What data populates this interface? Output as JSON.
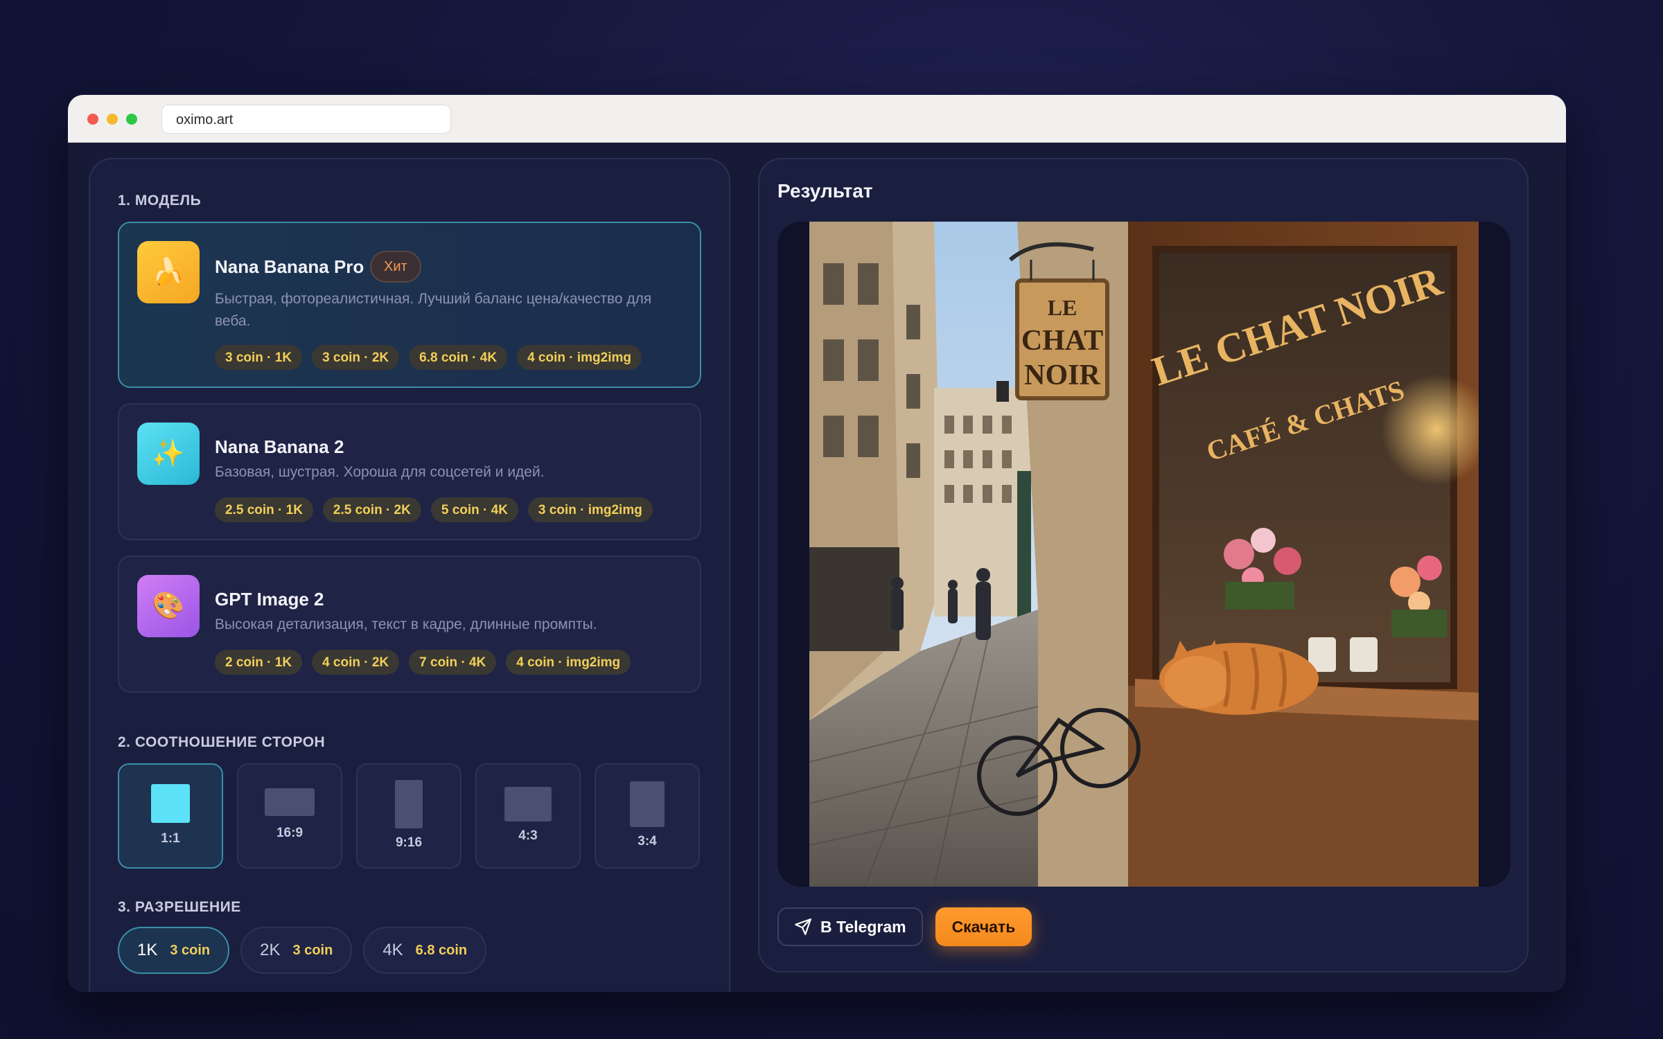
{
  "browser": {
    "url": "oximo.art"
  },
  "left": {
    "model_section_title": "1. МОДЕЛЬ",
    "models": [
      {
        "name": "Nana Banana Pro",
        "badge": "Хит",
        "icon": "banana-icon",
        "description": "Быстрая, фотореалистичная. Лучший баланс цена/качество для веба.",
        "prices": [
          "3 coin · 1K",
          "3 coin · 2K",
          "6.8 coin · 4K",
          "4 coin · img2img"
        ],
        "selected": true
      },
      {
        "name": "Nana Banana 2",
        "icon": "sparkles-icon",
        "description": "Базовая, шустрая. Хороша для соцсетей и идей.",
        "prices": [
          "2.5 coin · 1K",
          "2.5 coin · 2K",
          "5 coin · 4K",
          "3 coin · img2img"
        ],
        "selected": false
      },
      {
        "name": "GPT Image 2",
        "icon": "palette-icon",
        "description": "Высокая детализация, текст в кадре, длинные промпты.",
        "prices": [
          "2 coin · 1K",
          "4 coin · 2K",
          "7 coin · 4K",
          "4 coin · img2img"
        ],
        "selected": false
      }
    ],
    "ratio_section_title": "2. СООТНОШЕНИЕ СТОРОН",
    "ratios": [
      {
        "label": "1:1",
        "selected": true
      },
      {
        "label": "16:9",
        "selected": false
      },
      {
        "label": "9:16",
        "selected": false
      },
      {
        "label": "4:3",
        "selected": false
      },
      {
        "label": "3:4",
        "selected": false
      }
    ],
    "resolution_section_title": "3. РАЗРЕШЕНИЕ",
    "resolutions": [
      {
        "value": "1K",
        "cost": "3 coin",
        "selected": true
      },
      {
        "value": "2K",
        "cost": "3 coin",
        "selected": false
      },
      {
        "value": "4K",
        "cost": "6.8 coin",
        "selected": false
      }
    ]
  },
  "right": {
    "title": "Результат",
    "image": {
      "hanging_sign": [
        "LE",
        "CHAT",
        "NOIR"
      ],
      "window_text": [
        "LE CHAT NOIR",
        "CAFÉ & CHATS"
      ]
    },
    "telegram_label": "В Telegram",
    "download_label": "Скачать"
  },
  "colors": {
    "accent_cyan": "#3a8ea8",
    "price_gold": "#f2cf5a",
    "download_orange": "#f48a1c",
    "hit_orange": "#f39a52"
  }
}
